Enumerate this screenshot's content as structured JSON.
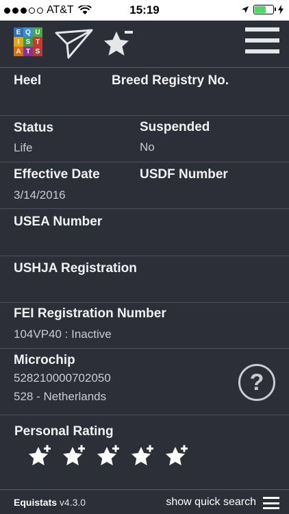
{
  "status_bar": {
    "carrier": "AT&T",
    "time": "15:19",
    "signal_bars": 3
  },
  "header": {
    "logo_letters": [
      "E",
      "Q",
      "U",
      "I",
      "S",
      "T",
      "A",
      "T",
      "S"
    ],
    "logo_colors": [
      "#2f6fb6",
      "#3a8fd1",
      "#4aa84b",
      "#e0a51b",
      "#3b9a3f",
      "#c23b2e",
      "#d46d1c",
      "#8d2f8f",
      "#b23b3b"
    ],
    "icons": [
      "paper-plane-icon",
      "star-minus-icon",
      "menu-icon"
    ]
  },
  "fields": {
    "heel": {
      "label": "Heel"
    },
    "breed_registry": {
      "label": "Breed Registry No."
    },
    "status": {
      "label": "Status",
      "value": "Life"
    },
    "suspended": {
      "label": "Suspended",
      "value": "No"
    },
    "effective_date": {
      "label": "Effective Date",
      "value": "3/14/2016"
    },
    "usdf": {
      "label": "USDF Number"
    },
    "usea": {
      "label": "USEA Number"
    },
    "ushja": {
      "label": "USHJA Registration"
    },
    "fei": {
      "label": "FEI Registration Number",
      "value": "104VP40 : Inactive"
    },
    "microchip": {
      "label": "Microchip",
      "value1": "528210000702050",
      "value2": "528 - Netherlands"
    }
  },
  "help_button": {
    "label": "?"
  },
  "rating": {
    "label": "Personal Rating",
    "stars": 5,
    "filled": 0
  },
  "footer": {
    "app_name": "Equistats",
    "version": "v4.3.0",
    "quick_search": "show quick search"
  }
}
